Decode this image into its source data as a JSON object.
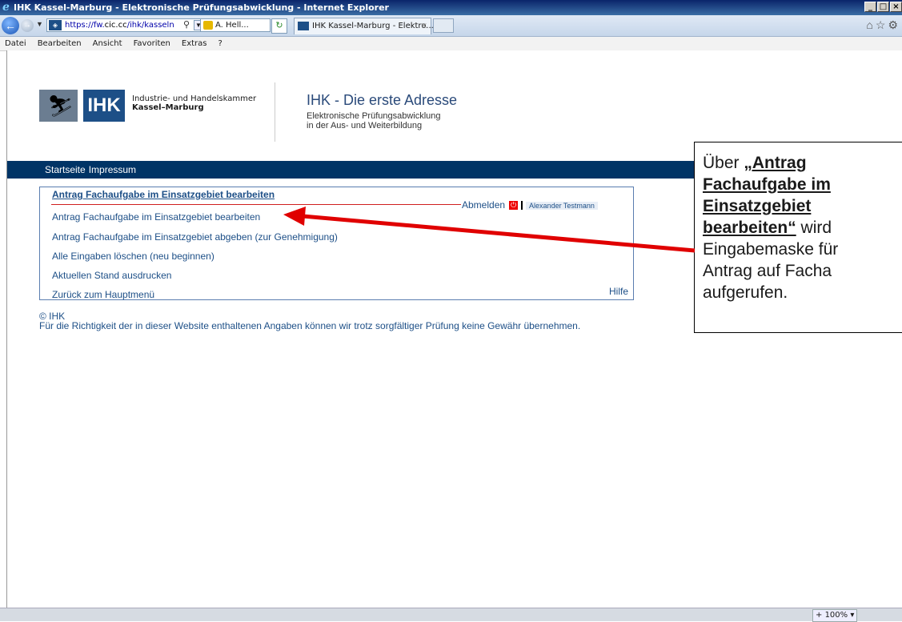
{
  "browser": {
    "title": "IHK Kassel-Marburg - Elektronische Prüfungsabwicklung - Internet Explorer",
    "url_scheme": "https://fw.",
    "url_host": "cic.cc",
    "url_path": "/ihk/kasseln",
    "cert_label": "A. Hell...",
    "tab_label": "IHK Kassel-Marburg - Elektro...",
    "tab_close": "×",
    "menu": [
      "Datei",
      "Bearbeiten",
      "Ansicht",
      "Favoriten",
      "Extras",
      "?"
    ],
    "zoom": "100%"
  },
  "header": {
    "logo_text": "IHK",
    "chamber_line1": "Industrie- und Handelskammer",
    "chamber_line2": "Kassel–Marburg",
    "slogan": "IHK - Die erste Adresse",
    "subtitle_line1": "Elektronische Prüfungsabwicklung",
    "subtitle_line2": "in der Aus- und Weiterbildung"
  },
  "nav": {
    "start": "Startseite",
    "impressum": "Impressum"
  },
  "menu_box": {
    "heading": "Antrag Fachaufgabe im Einsatzgebiet bearbeiten",
    "logout": "Abmelden",
    "user": "Alexander Testmann",
    "items": [
      "Antrag Fachaufgabe im Einsatzgebiet bearbeiten",
      "Antrag Fachaufgabe im Einsatzgebiet abgeben (zur Genehmigung)",
      "Alle Eingaben löschen (neu beginnen)",
      "Aktuellen Stand ausdrucken",
      "Zurück zum Hauptmenü"
    ],
    "help": "Hilfe"
  },
  "footer": {
    "copyright": "© IHK",
    "disclaimer": "Für die Richtigkeit der in dieser Website enthaltenen Angaben können wir trotz sorgfältiger Prüfung keine Gewähr übernehmen."
  },
  "callout": {
    "prefix": "Über ",
    "bold_l1": "„Antrag",
    "bold_l2": "Fachaufgabe im",
    "bold_l3": "Einsatzgebiet",
    "bold_l4": "bearbeiten“",
    "rest_l4": " wird",
    "line5": "Eingabemaske für",
    "line6": "Antrag auf Facha",
    "line7": "aufgerufen."
  },
  "colors": {
    "brand_blue": "#1d4f87",
    "nav_bar": "#003466",
    "arrow_red": "#e00000"
  }
}
